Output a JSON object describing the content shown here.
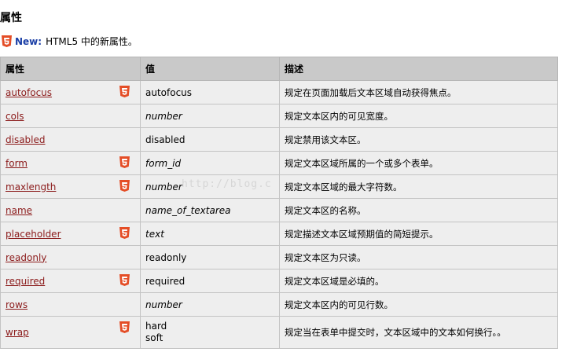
{
  "heading": "属性",
  "new_notice": {
    "label": "New:",
    "text": "HTML5 中的新属性。"
  },
  "table": {
    "headers": [
      "属性",
      "值",
      "描述"
    ],
    "rows": [
      {
        "attr": "autofocus",
        "html5": true,
        "value": "autofocus",
        "value_italic": false,
        "desc": "规定在页面加载后文本区域自动获得焦点。"
      },
      {
        "attr": "cols",
        "html5": false,
        "value": "number",
        "value_italic": true,
        "desc": "规定文本区内的可见宽度。"
      },
      {
        "attr": "disabled",
        "html5": false,
        "value": "disabled",
        "value_italic": false,
        "desc": "规定禁用该文本区。"
      },
      {
        "attr": "form",
        "html5": true,
        "value": "form_id",
        "value_italic": true,
        "desc": "规定文本区域所属的一个或多个表单。"
      },
      {
        "attr": "maxlength",
        "html5": true,
        "value": "number",
        "value_italic": true,
        "desc": "规定文本区域的最大字符数。"
      },
      {
        "attr": "name",
        "html5": false,
        "value": "name_of_textarea",
        "value_italic": true,
        "desc": "规定文本区的名称。"
      },
      {
        "attr": "placeholder",
        "html5": true,
        "value": "text",
        "value_italic": true,
        "desc": "规定描述文本区域预期值的简短提示。"
      },
      {
        "attr": "readonly",
        "html5": false,
        "value": "readonly",
        "value_italic": false,
        "desc": "规定文本区为只读。"
      },
      {
        "attr": "required",
        "html5": true,
        "value": "required",
        "value_italic": false,
        "desc": "规定文本区域是必填的。"
      },
      {
        "attr": "rows",
        "html5": false,
        "value": "number",
        "value_italic": true,
        "desc": "规定文本区内的可见行数。"
      },
      {
        "attr": "wrap",
        "html5": true,
        "value_lines": [
          "hard",
          "soft"
        ],
        "value_italic": false,
        "desc": "规定当在表单中提交时，文本区域中的文本如何换行。。"
      }
    ]
  },
  "watermark": "http://blog.c",
  "colors": {
    "link": "#8b1a1a",
    "new_label": "#1a3ea6",
    "html5_badge": "#e44d26",
    "header_bg": "#c9c9c9",
    "row_bg": "#eeeeee"
  }
}
